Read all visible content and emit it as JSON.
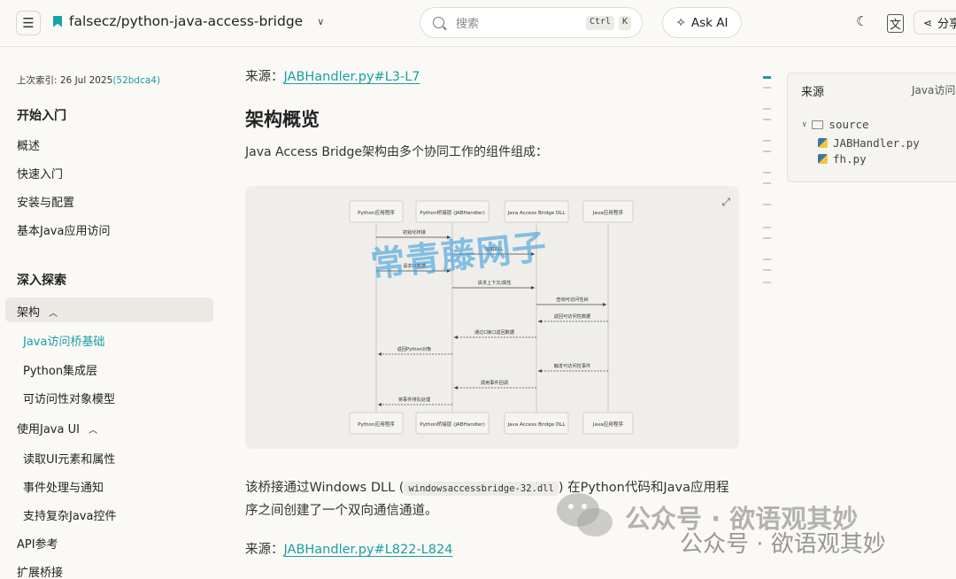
{
  "topbar": {
    "repo": "falsecz/python-java-access-bridge",
    "search_placeholder": "搜索",
    "kbd_ctrl": "Ctrl",
    "kbd_k": "K",
    "ask_ai": "Ask AI",
    "share": "分享"
  },
  "sidebar": {
    "indexed_prefix": "上次索引: 26 Jul 2025",
    "indexed_hash": "(52bdca4)",
    "section1": "开始入门",
    "s1_items": [
      "概述",
      "快速入门",
      "安装与配置",
      "基本Java应用访问"
    ],
    "section2": "深入探索",
    "arch": "架构",
    "arch_sub": [
      "Java访问桥基础",
      "Python集成层",
      "可访问性对象模型"
    ],
    "java_ui": "使用Java UI",
    "java_ui_sub": [
      "读取UI元素和属性",
      "事件处理与通知",
      "支持复杂Java控件"
    ],
    "api": "API参考",
    "ext": "扩展桥接"
  },
  "main": {
    "source_label": "来源：",
    "source_link_1": "JABHandler.py#L3-L7",
    "heading": "架构概览",
    "intro": "Java Access Bridge架构由多个协同工作的组件组成：",
    "para_before": "该桥接通过Windows DLL (",
    "para_code": "windowsaccessbridge-32.dll",
    "para_after": ") 在Python代码和Java应用程序之间创建了一个双向通信通道。",
    "source_link_2": "JABHandler.py#L822-L824"
  },
  "diagram": {
    "participants": [
      "Python应用程序",
      "Python桥接层 (JABHandler)",
      "Java Access Bridge DLL",
      "Java应用程序"
    ],
    "messages": [
      {
        "from": 0,
        "to": 1,
        "label": "初始化桥接"
      },
      {
        "from": 1,
        "to": 2,
        "label": "加载DLL"
      },
      {
        "from": 0,
        "to": 1,
        "label": "请求UI数据"
      },
      {
        "from": 1,
        "to": 2,
        "label": "请求上下文/属性"
      },
      {
        "from": 2,
        "to": 3,
        "label": "查询可访问性树"
      },
      {
        "from": 3,
        "to": 2,
        "label": "返回可访问性数据"
      },
      {
        "from": 2,
        "to": 1,
        "label": "通过C接口返回数据"
      },
      {
        "from": 1,
        "to": 0,
        "label": "返回Python对象"
      },
      {
        "from": 3,
        "to": 2,
        "label": "触发可访问性事件"
      },
      {
        "from": 2,
        "to": 1,
        "label": "调用事件回调"
      },
      {
        "from": 1,
        "to": 0,
        "label": "将事件排队处理"
      }
    ]
  },
  "src_panel": {
    "title": "来源",
    "right": "Java访问桥",
    "folder": "source",
    "files": [
      "JABHandler.py",
      "fh.py"
    ]
  },
  "watermark": {
    "big": "常青藤网子",
    "line1": "公众号 · 欲语观其妙",
    "line2": "公众号 · 欲语观其妙"
  }
}
